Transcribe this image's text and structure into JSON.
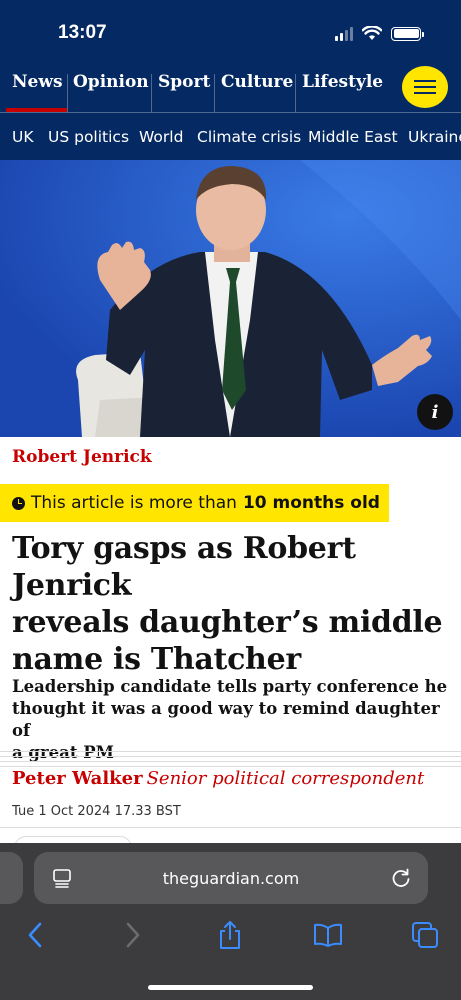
{
  "status_bar": {
    "time": "13:07"
  },
  "pillars": [
    {
      "label": "News",
      "active": true
    },
    {
      "label": "Opinion"
    },
    {
      "label": "Sport"
    },
    {
      "label": "Culture"
    },
    {
      "label": "Lifestyle"
    }
  ],
  "subnav": [
    "UK",
    "US politics",
    "World",
    "Climate crisis",
    "Middle East",
    "Ukraine"
  ],
  "hero": {
    "info_label": "i"
  },
  "article": {
    "kicker": "Robert Jenrick",
    "age_warning_prefix": "This article is more than",
    "age_warning_bold": "10 months old",
    "headline_lines": [
      "Tory gasps as Robert Jenrick",
      "reveals daughter’s middle",
      "name is Thatcher"
    ],
    "standfirst_lines": [
      "Leadership candidate tells party conference he",
      "thought it was a good way to remind daughter of",
      "a great PM"
    ],
    "author": "Peter Walker",
    "author_role": "Senior political correspondent",
    "date": "Tue 1 Oct 2024 17.33 BST"
  },
  "browser": {
    "url": "theguardian.com"
  },
  "colors": {
    "brand_blue": "#052962",
    "news_red": "#c70000",
    "highlight_yellow": "#ffe500"
  }
}
